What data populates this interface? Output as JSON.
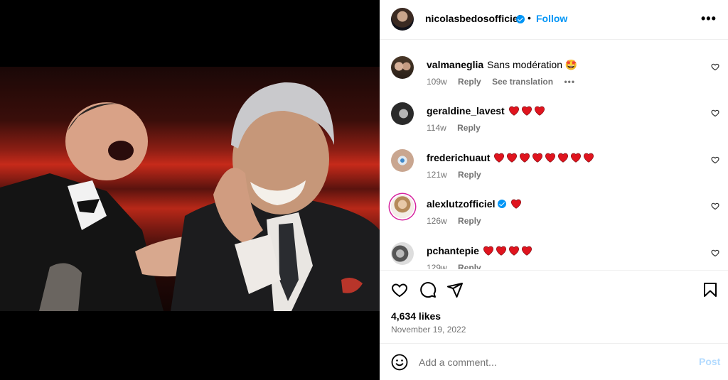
{
  "post": {
    "author": "nicolasbedosofficiel",
    "verified": true,
    "separator": "•",
    "follow_label": "Follow",
    "more_icon": "more-horizontal-icon",
    "image_alt_icon": "photo"
  },
  "comments": [
    {
      "user": "valmaneglia",
      "text": "Sans modération 🤩",
      "verified": false,
      "age": "109w",
      "reply": "Reply",
      "translation": "See translation",
      "more": "•••"
    },
    {
      "user": "geraldine_lavest",
      "text": "",
      "hearts": 3,
      "verified": false,
      "age": "114w",
      "reply": "Reply"
    },
    {
      "user": "frederichuaut",
      "text": "",
      "hearts": 8,
      "verified": false,
      "age": "121w",
      "reply": "Reply"
    },
    {
      "user": "alexlutzofficiel",
      "text": "",
      "hearts": 1,
      "verified": true,
      "age": "126w",
      "reply": "Reply"
    },
    {
      "user": "pchantepie",
      "text": "",
      "hearts": 4,
      "verified": false,
      "age": "129w",
      "reply": "Reply"
    }
  ],
  "actions": {
    "likes": "4,634 likes",
    "date": "November 19, 2022"
  },
  "add_comment": {
    "placeholder": "Add a comment...",
    "post_label": "Post"
  },
  "colors": {
    "accent": "#0095f6",
    "muted": "#737373",
    "post_disabled": "#b3dbff",
    "heart": "#e0141e"
  }
}
